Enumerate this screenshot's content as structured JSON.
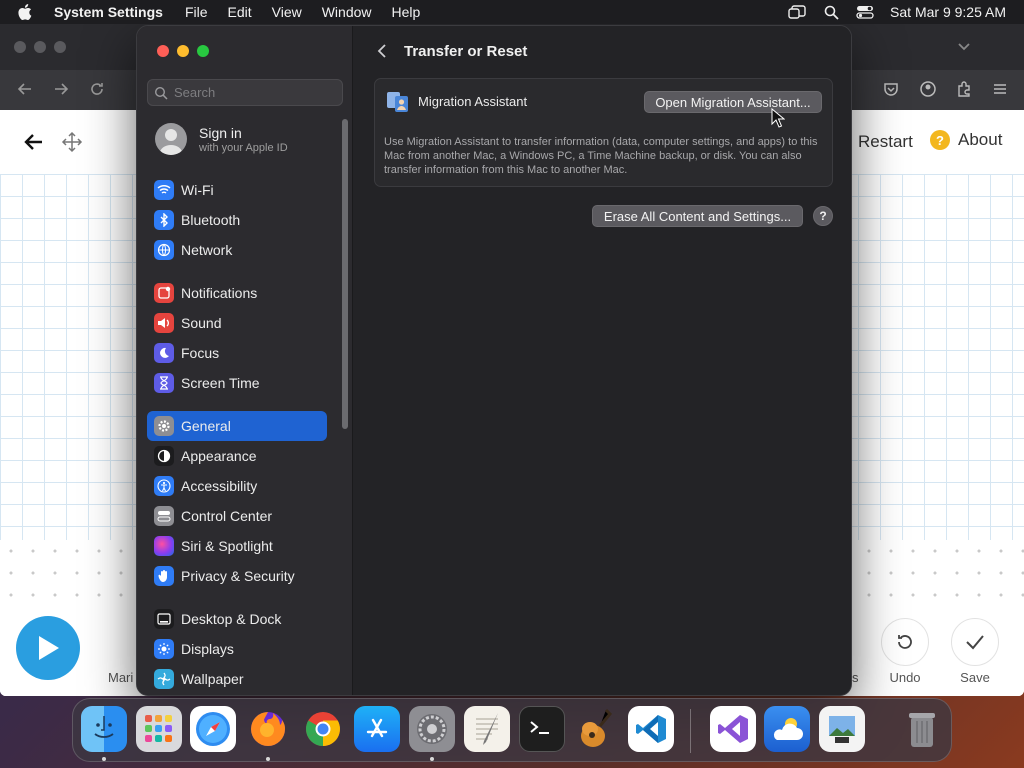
{
  "menubar": {
    "app_name": "System Settings",
    "menus": [
      "File",
      "Edit",
      "View",
      "Window",
      "Help"
    ],
    "clock": "Sat Mar 9  9:25 AM"
  },
  "browser_page": {
    "restart_label": "Restart",
    "about_label": "About",
    "about_glyph": "?",
    "bottom_left_label": "Mari",
    "bottom_clip_label": "s",
    "undo_label": "Undo",
    "save_label": "Save"
  },
  "settings": {
    "search_placeholder": "Search",
    "account": {
      "title": "Sign in",
      "subtitle": "with your Apple ID"
    },
    "sidebar": [
      {
        "label": "Wi-Fi",
        "icon": "wifi-icon",
        "color": "#2f7cf6"
      },
      {
        "label": "Bluetooth",
        "icon": "bluetooth-icon",
        "color": "#2f7cf6"
      },
      {
        "label": "Network",
        "icon": "network-icon",
        "color": "#2f7cf6"
      },
      {
        "label": "Notifications",
        "icon": "notifications-icon",
        "color": "#e5443e"
      },
      {
        "label": "Sound",
        "icon": "sound-icon",
        "color": "#e5443e"
      },
      {
        "label": "Focus",
        "icon": "focus-icon",
        "color": "#5e5ce6"
      },
      {
        "label": "Screen Time",
        "icon": "screen-time-icon",
        "color": "#5e5ce6"
      },
      {
        "label": "General",
        "icon": "gear-icon",
        "color": "#8e8e93",
        "active": true
      },
      {
        "label": "Appearance",
        "icon": "appearance-icon",
        "color": "#1c1c1e"
      },
      {
        "label": "Accessibility",
        "icon": "accessibility-icon",
        "color": "#2f7cf6"
      },
      {
        "label": "Control Center",
        "icon": "control-center-icon",
        "color": "#8e8e93"
      },
      {
        "label": "Siri & Spotlight",
        "icon": "siri-icon",
        "color": "#b04fe0"
      },
      {
        "label": "Privacy & Security",
        "icon": "hand-icon",
        "color": "#2f7cf6"
      },
      {
        "label": "Desktop & Dock",
        "icon": "desktop-dock-icon",
        "color": "#1c1c1e"
      },
      {
        "label": "Displays",
        "icon": "displays-icon",
        "color": "#2f7cf6"
      },
      {
        "label": "Wallpaper",
        "icon": "wallpaper-icon",
        "color": "#34aadc"
      }
    ],
    "page_title": "Transfer or Reset",
    "migration": {
      "label": "Migration Assistant",
      "button": "Open Migration Assistant...",
      "description": "Use Migration Assistant to transfer information (data, computer settings, and apps) to this Mac from another Mac, a Windows PC, a Time Machine backup, or disk. You can also transfer information from this Mac to another Mac."
    },
    "erase_button": "Erase All Content and Settings...",
    "help_glyph": "?"
  },
  "dock": [
    {
      "name": "finder-icon",
      "running": true
    },
    {
      "name": "launchpad-icon",
      "running": false
    },
    {
      "name": "safari-icon",
      "running": false
    },
    {
      "name": "firefox-icon",
      "running": true
    },
    {
      "name": "chrome-icon",
      "running": false
    },
    {
      "name": "app-store-icon",
      "running": false
    },
    {
      "name": "system-settings-icon",
      "running": true
    },
    {
      "name": "textedit-icon",
      "running": false
    },
    {
      "name": "terminal-icon",
      "running": false
    },
    {
      "name": "garageband-icon",
      "running": false
    },
    {
      "name": "vscode-icon",
      "running": false
    },
    {
      "name": "visual-studio-icon",
      "running": false
    },
    {
      "name": "weather-icon",
      "running": false
    },
    {
      "name": "preview-icon",
      "running": false
    },
    {
      "name": "trash-icon",
      "running": false
    }
  ]
}
